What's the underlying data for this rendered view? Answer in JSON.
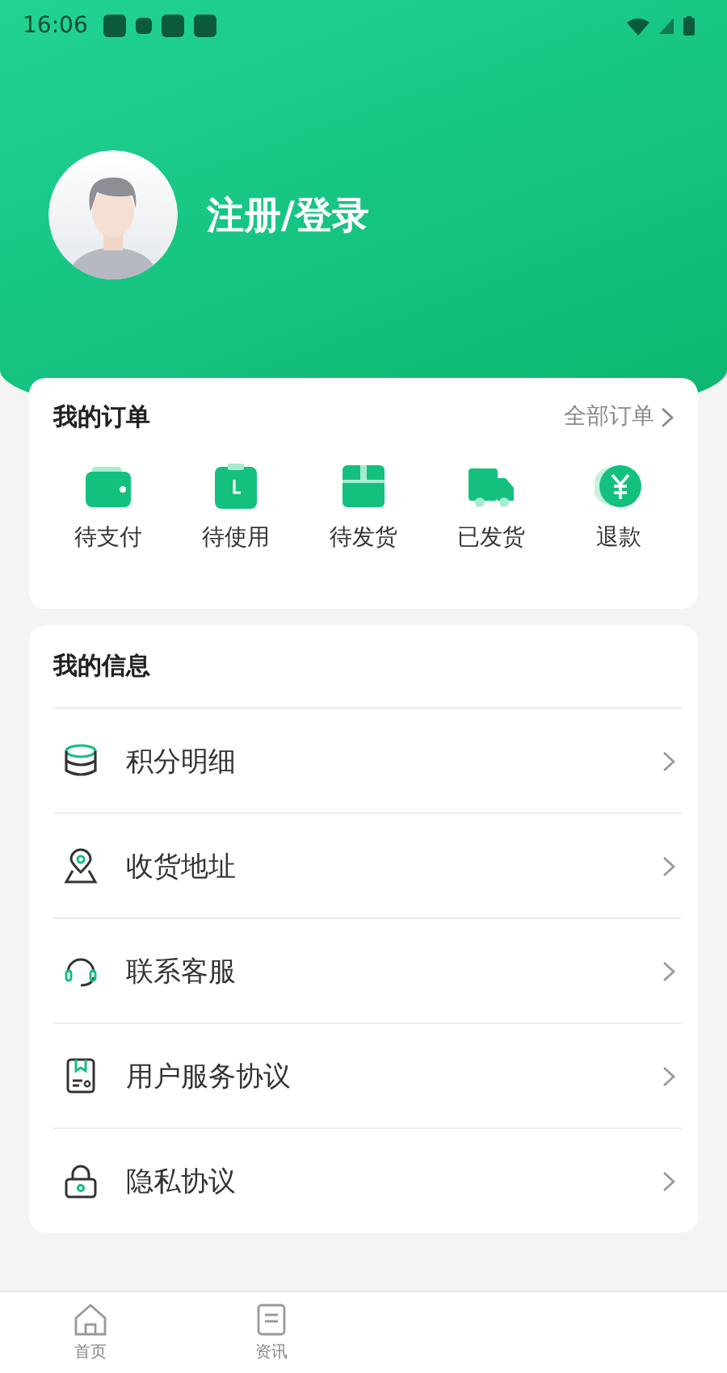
{
  "status_bar": {
    "time": "16:06"
  },
  "profile": {
    "login_label": "注册/登录"
  },
  "orders": {
    "title": "我的订单",
    "all_link": "全部订单",
    "items": [
      {
        "kind": "wallet",
        "label": "待支付"
      },
      {
        "kind": "clock",
        "label": "待使用"
      },
      {
        "kind": "box",
        "label": "待发货"
      },
      {
        "kind": "truck",
        "label": "已发货"
      },
      {
        "kind": "refund",
        "label": "退款"
      }
    ]
  },
  "info": {
    "title": "我的信息",
    "items": [
      {
        "kind": "points",
        "label": "积分明细"
      },
      {
        "kind": "address",
        "label": "收货地址"
      },
      {
        "kind": "service",
        "label": "联系客服"
      },
      {
        "kind": "agreement",
        "label": "用户服务协议"
      },
      {
        "kind": "privacy",
        "label": "隐私协议"
      }
    ]
  },
  "tab_bar": [
    {
      "kind": "home",
      "label": "首页",
      "selected": false
    },
    {
      "kind": "news",
      "label": "资讯",
      "selected": false
    }
  ]
}
